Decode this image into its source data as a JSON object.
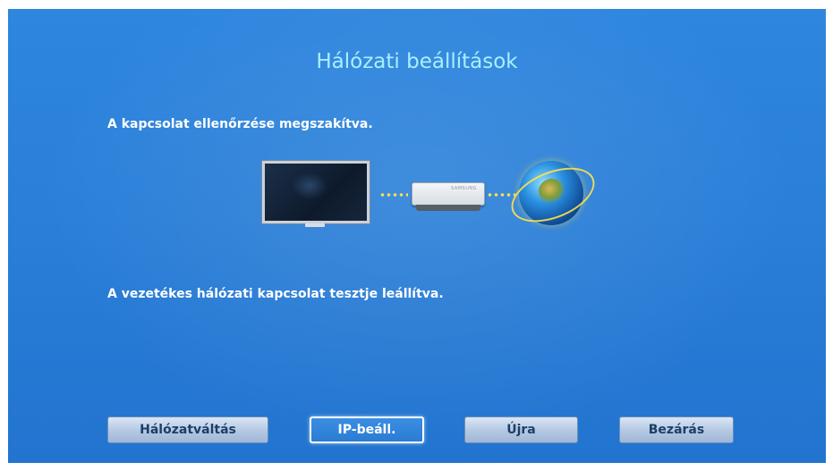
{
  "dialog": {
    "title": "Hálózati beállítások",
    "message_top": "A kapcsolat ellenőrzése megszakítva.",
    "message_bottom": "A vezetékes hálózati kapcsolat tesztje leállítva."
  },
  "illustration": {
    "router_brand": "SAMSUNG",
    "icons": [
      "tv-icon",
      "router-icon",
      "globe-icon"
    ],
    "connection_color": "#ffe24a"
  },
  "buttons": {
    "network_change": "Hálózatváltás",
    "ip_settings": "IP-beáll.",
    "retry": "Újra",
    "close": "Bezárás",
    "focused": "ip_settings"
  },
  "colors": {
    "background": "#2a7fd8",
    "title": "#a8f0ff",
    "text": "#ffffff"
  }
}
